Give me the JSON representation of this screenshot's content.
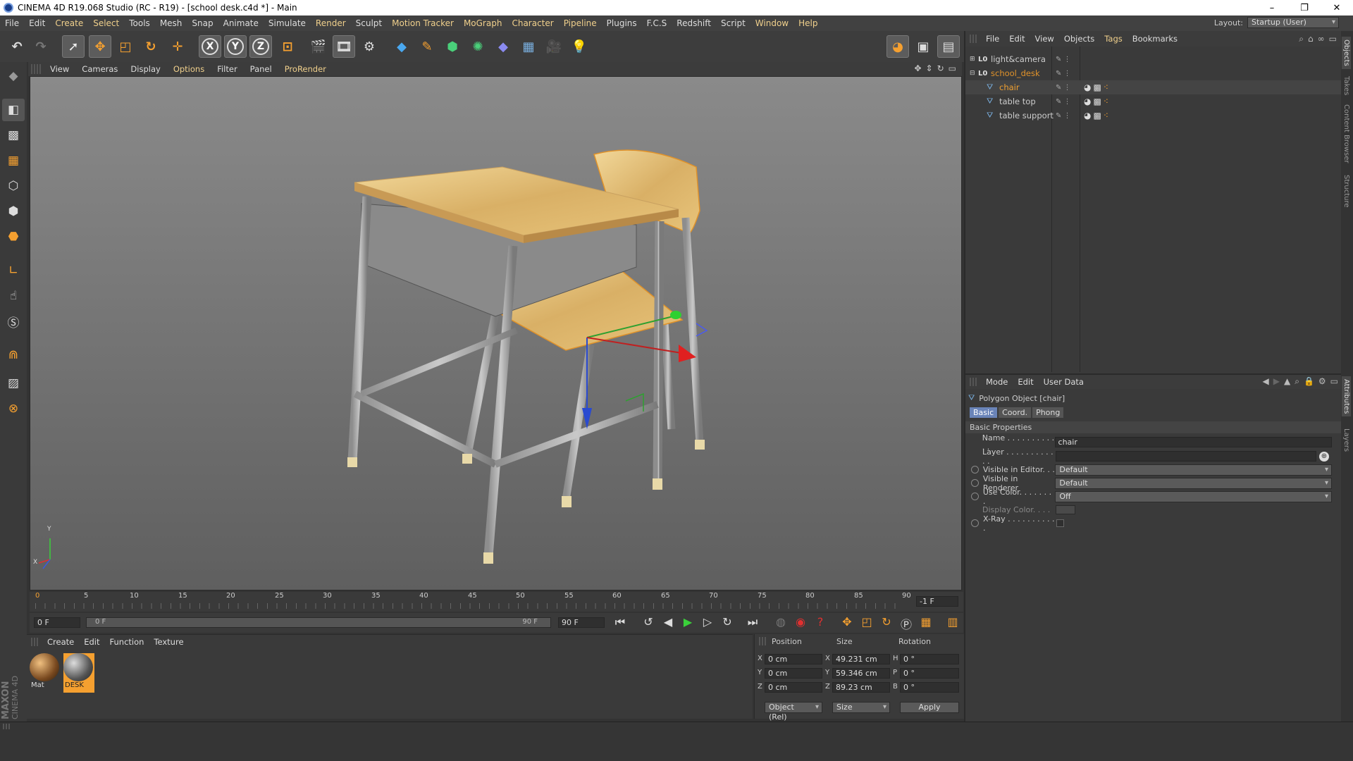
{
  "window": {
    "title": "CINEMA 4D R19.068 Studio (RC - R19) - [school desk.c4d *] - Main"
  },
  "menubar": {
    "items": [
      "File",
      "Edit",
      "Create",
      "Select",
      "Tools",
      "Mesh",
      "Snap",
      "Animate",
      "Simulate",
      "Render",
      "Sculpt",
      "Motion Tracker",
      "MoGraph",
      "Character",
      "Pipeline",
      "Plugins",
      "F.C.S",
      "Redshift",
      "Script",
      "Window",
      "Help"
    ],
    "layout_label": "Layout:",
    "layout_value": "Startup (User)"
  },
  "toolbar": {
    "icons": [
      "undo-icon",
      "redo-icon",
      "live-selection-icon",
      "move-icon",
      "scale-icon",
      "rotate-icon",
      "recent-tool-icon",
      "x-axis-icon",
      "y-axis-icon",
      "z-axis-icon",
      "world-coordinates-icon",
      "render-view-icon",
      "render-picture-viewer-icon",
      "edit-render-settings-icon",
      "cube-icon",
      "pen-icon",
      "subdivision-icon",
      "cloner-icon",
      "deformer-icon",
      "floor-icon",
      "camera-icon",
      "light-icon"
    ],
    "axis_labels": [
      "X",
      "Y",
      "Z"
    ],
    "right_icons": [
      "ball-icon",
      "texture-icon",
      "layout-icon"
    ]
  },
  "left_tools": [
    "make-editable-icon",
    "model-mode-icon",
    "texture-mode-icon",
    "workplane-icon",
    "points-mode-icon",
    "edges-mode-icon",
    "polygons-mode-icon",
    "axis-icon",
    "tweak-icon",
    "solo-icon",
    "magnet-icon",
    "snap-lock-icon",
    "snap-icon"
  ],
  "viewport": {
    "menu": [
      "View",
      "Cameras",
      "Display",
      "Options",
      "Filter",
      "Panel",
      "ProRender"
    ],
    "axis_labels": {
      "y": "Y",
      "x": "X"
    }
  },
  "timeline": {
    "ticks": [
      "0",
      "5",
      "10",
      "15",
      "20",
      "25",
      "30",
      "35",
      "40",
      "45",
      "50",
      "55",
      "60",
      "65",
      "70",
      "75",
      "80",
      "85",
      "90"
    ],
    "end_field": "-1 F",
    "current_frame": "0 F",
    "range_start": "0 F",
    "range_end": "90 F",
    "max_frame": "90 F"
  },
  "materials": {
    "menu": [
      "Create",
      "Edit",
      "Function",
      "Texture"
    ],
    "items": [
      {
        "name": "Mat",
        "selected": false
      },
      {
        "name": "DESK",
        "selected": true
      }
    ]
  },
  "coords": {
    "headers": [
      "Position",
      "Size",
      "Rotation"
    ],
    "rows": [
      {
        "axis": "X",
        "pos": "0 cm",
        "size_axis": "X",
        "size": "49.231 cm",
        "rot_axis": "H",
        "rot": "0 °"
      },
      {
        "axis": "Y",
        "pos": "0 cm",
        "size_axis": "Y",
        "size": "59.346 cm",
        "rot_axis": "P",
        "rot": "0 °"
      },
      {
        "axis": "Z",
        "pos": "0 cm",
        "size_axis": "Z",
        "size": "89.23 cm",
        "rot_axis": "B",
        "rot": "0 °"
      }
    ],
    "mode": "Object (Rel)",
    "size_mode": "Size",
    "apply": "Apply"
  },
  "object_manager": {
    "menu": [
      "File",
      "Edit",
      "View",
      "Objects",
      "Tags",
      "Bookmarks"
    ],
    "objects": [
      {
        "name": "light&camera",
        "color": "#cccccc",
        "indent": 0,
        "tags": false
      },
      {
        "name": "school_desk",
        "color": "#e0922a",
        "indent": 0,
        "tags": false
      },
      {
        "name": "chair",
        "color": "#f0a030",
        "indent": 1,
        "tags": true
      },
      {
        "name": "table top",
        "color": "#cccccc",
        "indent": 1,
        "tags": true
      },
      {
        "name": "table support",
        "color": "#cccccc",
        "indent": 1,
        "tags": true
      }
    ]
  },
  "attributes": {
    "menu": [
      "Mode",
      "Edit",
      "User Data"
    ],
    "title": "Polygon Object [chair]",
    "tabs": [
      "Basic",
      "Coord.",
      "Phong"
    ],
    "section": "Basic Properties",
    "props": [
      {
        "label": "Name . . . . . . . . . . . .",
        "value": "chair",
        "radio": false
      },
      {
        "label": "Layer . . . . . . . . . . . .",
        "value": "",
        "radio": false
      },
      {
        "label": "Visible in Editor. . .",
        "value": "Default",
        "radio": true
      },
      {
        "label": "Visible in Renderer",
        "value": "Default",
        "radio": true
      },
      {
        "label": "Use Color. . . . . . . .",
        "value": "Off",
        "radio": true
      },
      {
        "label": "Display Color. . . .",
        "value": "",
        "radio": false
      },
      {
        "label": "X-Ray . . . . . . . . . . .",
        "value": "",
        "radio": true
      }
    ]
  },
  "side_tabs": [
    "Objects",
    "Takes",
    "Content Browser",
    "Structure",
    "Attributes",
    "Layers"
  ],
  "branding": {
    "maxon": "MAXON",
    "product": "CINEMA 4D"
  }
}
